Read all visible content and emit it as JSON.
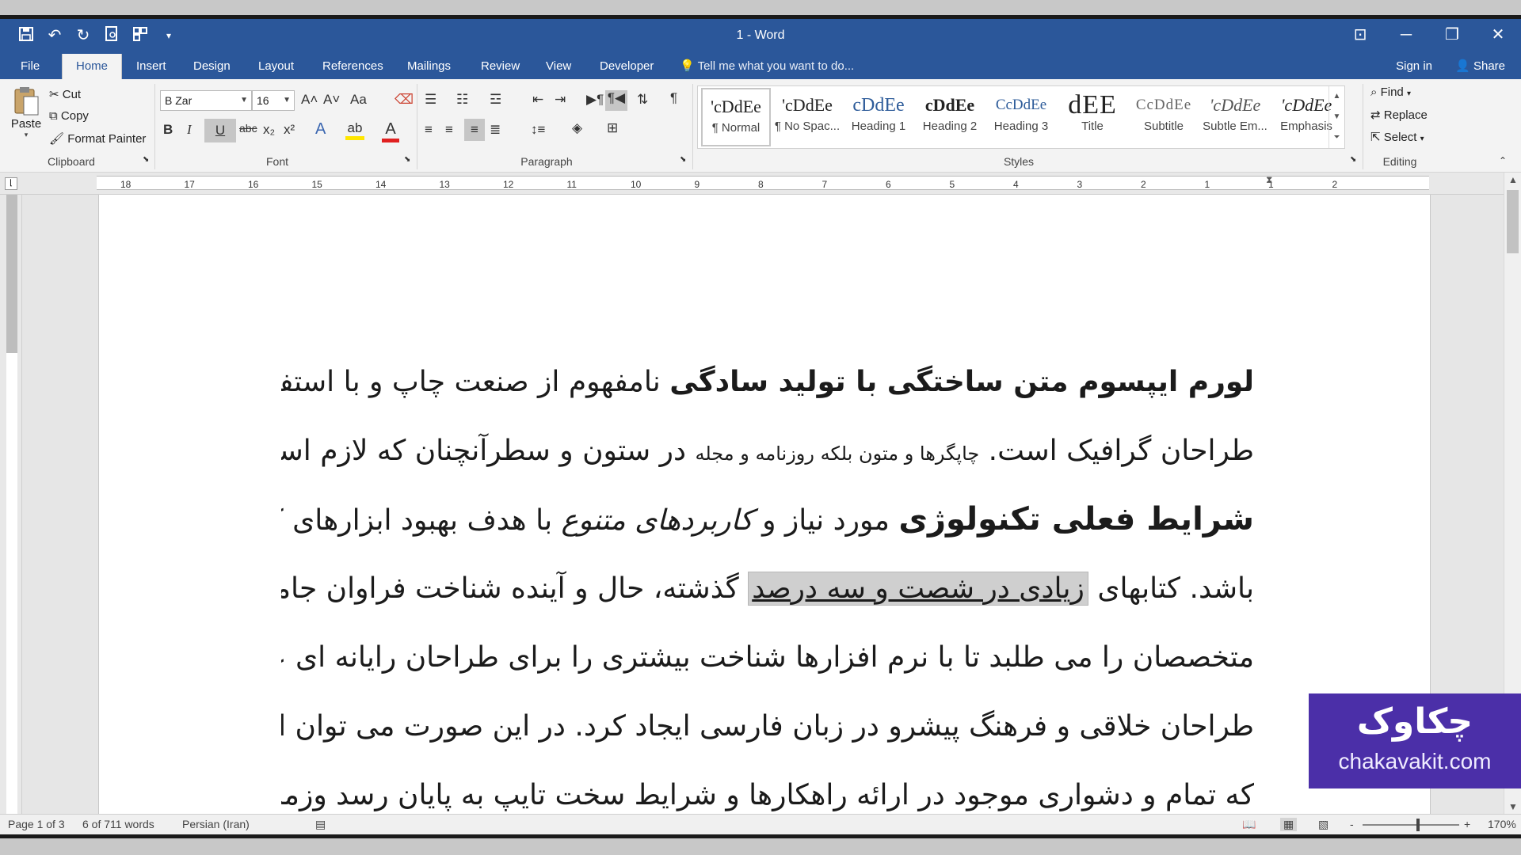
{
  "window": {
    "title": "1 - Word",
    "minimize": "─",
    "restore": "❐",
    "close": "✕",
    "ribbon_display": "⊡"
  },
  "qat": [
    "save-icon",
    "undo-icon",
    "redo-icon",
    "print-preview-icon",
    "touch-mode-icon",
    "customize-icon"
  ],
  "tabs": [
    {
      "label": "File"
    },
    {
      "label": "Home"
    },
    {
      "label": "Insert"
    },
    {
      "label": "Design"
    },
    {
      "label": "Layout"
    },
    {
      "label": "References"
    },
    {
      "label": "Mailings"
    },
    {
      "label": "Review"
    },
    {
      "label": "View"
    },
    {
      "label": "Developer"
    }
  ],
  "tellme": "Tell me what you want to do...",
  "signin": "Sign in",
  "share": "Share",
  "clipboard": {
    "paste": "Paste",
    "cut": "Cut",
    "copy": "Copy",
    "format_painter": "Format Painter",
    "label": "Clipboard"
  },
  "font": {
    "name": "B Zar",
    "size": "16",
    "label": "Font",
    "bold": "B",
    "italic": "I",
    "underline": "U",
    "strike": "abc",
    "sub": "x₂",
    "sup": "x²",
    "case": "Aa",
    "grow": "A˄",
    "shrink": "A˅",
    "effects": "A",
    "highlight": "ab",
    "color": "A"
  },
  "paragraph": {
    "label": "Paragraph",
    "pilcrow": "¶"
  },
  "styles": {
    "label": "Styles",
    "items": [
      {
        "preview": "'cDdEe",
        "name": "¶ Normal"
      },
      {
        "preview": "'cDdEe",
        "name": "¶ No Spac..."
      },
      {
        "preview": "cDdEe",
        "name": "Heading 1"
      },
      {
        "preview": "cDdEe",
        "name": "Heading 2"
      },
      {
        "preview": "CcDdEe",
        "name": "Heading 3"
      },
      {
        "preview": "dEE",
        "name": "Title"
      },
      {
        "preview": "CcDdEe",
        "name": "Subtitle"
      },
      {
        "preview": "'cDdEe",
        "name": "Subtle Em..."
      },
      {
        "preview": "'cDdEe",
        "name": "Emphasis"
      }
    ]
  },
  "editing": {
    "label": "Editing",
    "find": "Find",
    "replace": "Replace",
    "select": "Select"
  },
  "ruler": {
    "numbers": [
      "18",
      "17",
      "16",
      "15",
      "14",
      "13",
      "12",
      "11",
      "10",
      "9",
      "8",
      "7",
      "6",
      "5",
      "4",
      "3",
      "2",
      "1",
      "1",
      "2"
    ]
  },
  "document": {
    "l1_bold": "لورم ایپسوم متن ساختگی با تولید سادگی",
    "l1_rest": " نامفهوم از صنعت چاپ و با استفاده از",
    "l2_a": "طراحان گرافیک است. ",
    "l2_small": "چاپگرها و متون بلکه روزنامه و مجله",
    "l2_b": " در ستون و سطرآنچنان که لازم است و برای",
    "l3_bold": "شرایط فعلی تکنولوژی",
    "l3_a": " مورد نیاز و ",
    "l3_italic": "کاربردهای متنوع",
    "l3_b": " با هدف بهبود ابزارهای کاربردی می",
    "l4_a": "باشد. کتابهای ",
    "l4_hl": "زیادی در شصت و سه درصد",
    "l4_b": " گذشته، حال و آینده شناخت فراوان جامعه و",
    "l5": "متخصصان را می طلبد تا با نرم افزارها شناخت بیشتری را برای طراحان رایانه ای علی الخصوص",
    "l6": "طراحان خلاقی و فرهنگ پیشرو در زبان فارسی ایجاد کرد. در این صورت می توان امید داشت",
    "l7": "که تمام و دشواری موجود در ارائه راهکارها و شرایط سخت تایپ به پایان رسد وزمان مورد نیاز"
  },
  "status": {
    "page": "Page 1 of 3",
    "words": "6 of 711 words",
    "lang": "Persian (Iran)",
    "zoom": "170%",
    "zoom_minus": "-",
    "zoom_plus": "+"
  },
  "watermark": {
    "fa": "چکاوک",
    "en": "chakavakit.com"
  },
  "colors": {
    "brand": "#2b579a",
    "ribbon": "#f3f3f3",
    "watermark": "#4b2fa8"
  }
}
